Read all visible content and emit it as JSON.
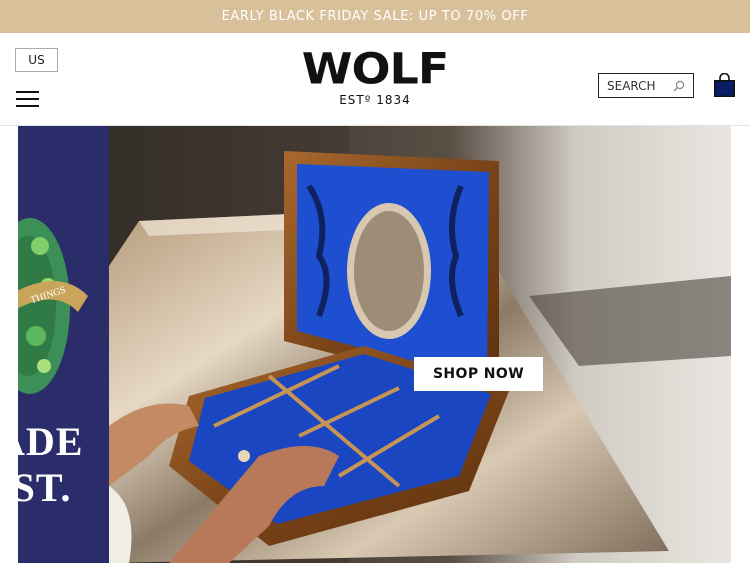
{
  "promo": {
    "text": "EARLY BLACK FRIDAY SALE: UP TO 70% OFF"
  },
  "header": {
    "region": "US",
    "logo_word": "WOLF",
    "logo_est": "ESTº 1834",
    "search_placeholder": "SEARCH"
  },
  "hero": {
    "side_line1": "ADE",
    "side_line2": "IST.",
    "banner_text": "THINGS",
    "cta": "SHOP NOW"
  },
  "icons": [
    "menu-icon",
    "search-icon",
    "shopping-bag-icon"
  ],
  "colors": {
    "promo_bg": "#d8c09a",
    "side_panel": "#2b2d6b",
    "box_lining": "#1d4fd0"
  }
}
